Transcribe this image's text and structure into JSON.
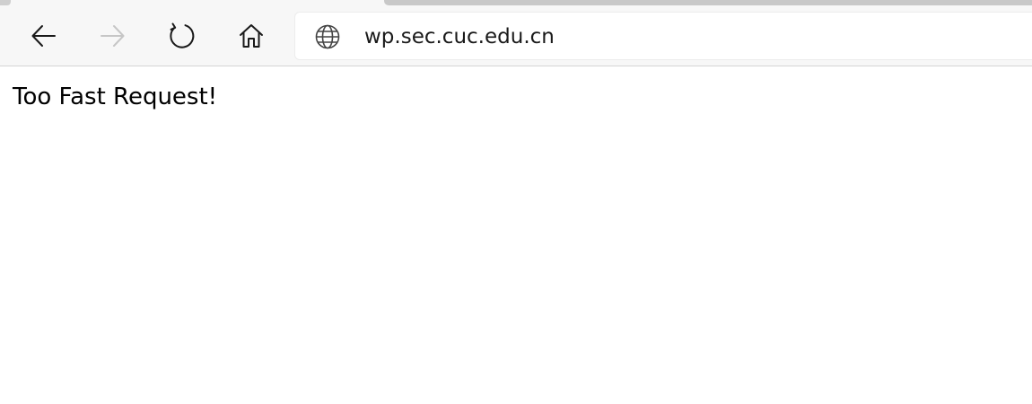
{
  "browser": {
    "toolbar": {
      "back_icon": "arrow-left",
      "forward_icon": "arrow-right",
      "forward_enabled": false,
      "refresh_icon": "refresh",
      "home_icon": "home"
    },
    "address_bar": {
      "site_icon": "globe",
      "url": "wp.sec.cuc.edu.cn"
    }
  },
  "page": {
    "message": "Too Fast Request!"
  },
  "colors": {
    "toolbar_background": "#f7f7f7",
    "icon_active": "#1a1a1a",
    "icon_disabled": "#c6c6c6",
    "page_background": "#ffffff"
  }
}
